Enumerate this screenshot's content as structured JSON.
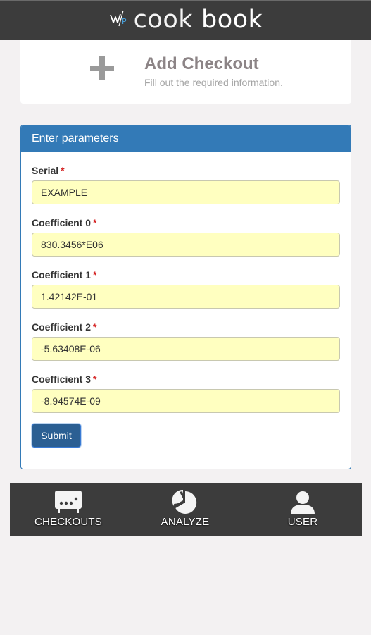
{
  "header": {
    "brand_word1": "cook",
    "brand_word2": "book",
    "logo_icon": "wp-logo-icon"
  },
  "add_checkout": {
    "icon": "plus-icon",
    "title": "Add Checkout",
    "subtitle": "Fill out the required information."
  },
  "form": {
    "heading": "Enter parameters",
    "required_mark": "*",
    "fields": [
      {
        "label": "Serial",
        "value": "EXAMPLE"
      },
      {
        "label": "Coefficient 0",
        "value": "830.3456*E06"
      },
      {
        "label": "Coefficient 1",
        "value": "1.42142E-01"
      },
      {
        "label": "Coefficient 2",
        "value": "-5.63408E-06"
      },
      {
        "label": "Coefficient 3",
        "value": "-8.94574E-09"
      }
    ],
    "submit_label": "Submit"
  },
  "nav": {
    "items": [
      {
        "label": "CHECKOUTS",
        "icon": "device-icon"
      },
      {
        "label": "ANALYZE",
        "icon": "pie-chart-icon"
      },
      {
        "label": "USER",
        "icon": "user-icon"
      }
    ]
  },
  "colors": {
    "topbar": "#3c3c3c",
    "panel_accent": "#337ab7",
    "input_bg": "#ffffc0",
    "required": "#d42020",
    "submit_bg": "#2b5f93"
  }
}
